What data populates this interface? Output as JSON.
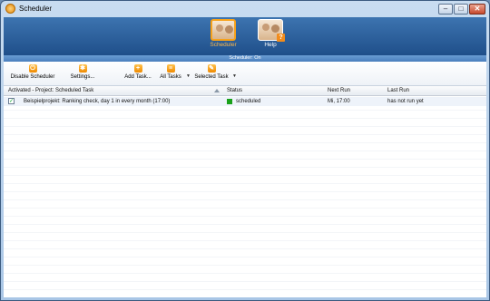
{
  "window": {
    "title": "Scheduler"
  },
  "nav": [
    {
      "label": "Scheduler",
      "icon": "scheduler-photo-icon",
      "active": true
    },
    {
      "label": "Help",
      "icon": "help-photo-icon",
      "active": false
    }
  ],
  "status": {
    "text": "Scheduler: On"
  },
  "toolbar": {
    "disable_scheduler": "Disable Scheduler",
    "settings": "Settings...",
    "add_task": "Add Task...",
    "all_tasks": "All Tasks",
    "selected_task": "Selected Task"
  },
  "table": {
    "headers": {
      "task": "Activated - Project: Scheduled Task",
      "status": "Status",
      "next_run": "Next Run",
      "last_run": "Last Run"
    },
    "rows": [
      {
        "checked": true,
        "task": "Beispielprojekt: Ranking check, day 1 in every month (17:00)",
        "status": "scheduled",
        "status_color": "#1aa11a",
        "next_run": "Mi, 17:00",
        "last_run": "has not run yet"
      }
    ]
  },
  "colors": {
    "accent": "#f7a21b",
    "banner": "#2a5e9a",
    "status_green": "#1aa11a"
  }
}
